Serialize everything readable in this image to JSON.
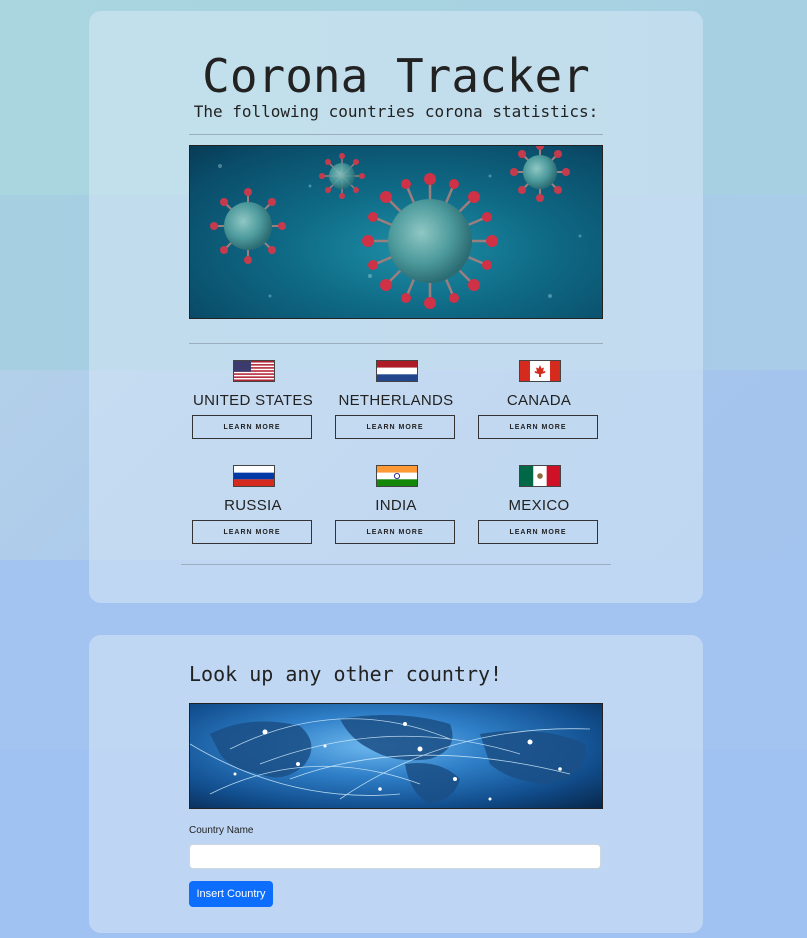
{
  "header": {
    "title": "Corona Tracker",
    "subtitle": "The following countries corona statistics:"
  },
  "banner_image": {
    "icon": "virus-image",
    "description_color": "#0f6b86"
  },
  "countries": [
    {
      "name": "UNITED STATES",
      "flag": "us-flag",
      "button_label": "LEARN MORE"
    },
    {
      "name": "NETHERLANDS",
      "flag": "netherlands-flag",
      "button_label": "LEARN MORE"
    },
    {
      "name": "CANADA",
      "flag": "canada-flag",
      "button_label": "LEARN MORE"
    },
    {
      "name": "RUSSIA",
      "flag": "russia-flag",
      "button_label": "LEARN MORE"
    },
    {
      "name": "INDIA",
      "flag": "india-flag",
      "button_label": "LEARN MORE"
    },
    {
      "name": "MEXICO",
      "flag": "mexico-flag",
      "button_label": "LEARN MORE"
    }
  ],
  "lookup": {
    "heading": "Look up any other country!",
    "globe_image": "globe-network-image",
    "field_label": "Country Name",
    "input_value": "",
    "input_placeholder": "",
    "submit_label": "Insert Country"
  },
  "colors": {
    "primary_button": "#0d6efd",
    "text": "#222222"
  }
}
